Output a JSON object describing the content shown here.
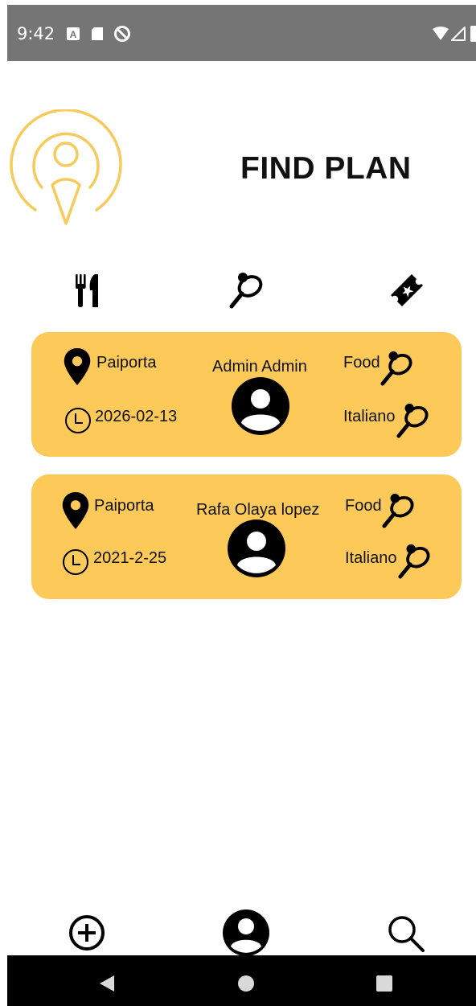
{
  "status_bar": {
    "time": "9:42",
    "a_badge": "A"
  },
  "header": {
    "title": "FIND PLAN"
  },
  "categories": [
    {
      "name": "food",
      "icon": "fork-knife-icon"
    },
    {
      "name": "sports",
      "icon": "racket-ball-icon"
    },
    {
      "name": "events",
      "icon": "ticket-icon"
    }
  ],
  "plans": [
    {
      "location": "Paiporta",
      "date": "2026-02-13",
      "user": "Admin Admin",
      "category": "Food",
      "subcategory": "Italiano"
    },
    {
      "location": "Paiporta",
      "date": "2021-2-25",
      "user": "Rafa Olaya lopez",
      "category": "Food",
      "subcategory": "Italiano"
    }
  ],
  "bottom_nav": [
    {
      "name": "create",
      "icon": "plus-circle-icon"
    },
    {
      "name": "profile",
      "icon": "user-circle-icon"
    },
    {
      "name": "search",
      "icon": "search-icon"
    }
  ],
  "colors": {
    "accent": "#fdca5a",
    "logo": "#f6cb5c",
    "statusbar": "#757575"
  }
}
